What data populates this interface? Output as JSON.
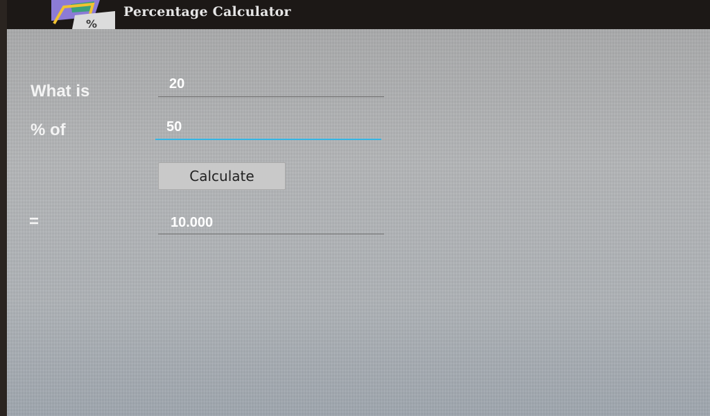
{
  "app": {
    "title": "Percentage Calculator",
    "icon": "percent-app-icon"
  },
  "form": {
    "what_is_label": "What is",
    "what_is_value": "20",
    "percent_of_label": "% of",
    "percent_of_value": "50",
    "calculate_label": "Calculate",
    "equals_label": "=",
    "result_value": "10.000"
  },
  "colors": {
    "accent": "#33b5e5",
    "action_bar": "#1c1816",
    "label_text": "#f4f4f4"
  }
}
